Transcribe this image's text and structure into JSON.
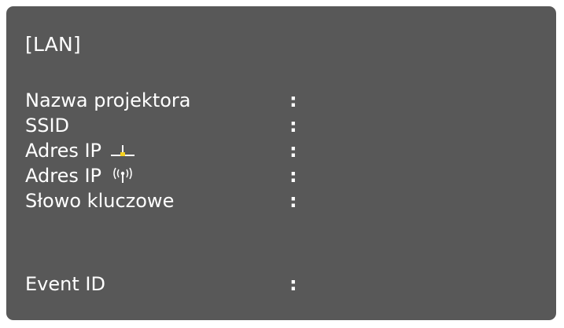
{
  "panel": {
    "title": "[LAN]"
  },
  "rows": [
    {
      "label": "Nazwa projektora",
      "separator": ":",
      "value": ""
    },
    {
      "label": "SSID",
      "separator": ":",
      "value": ""
    },
    {
      "label": "Adres IP",
      "icon": "wired-lan-icon",
      "separator": ":",
      "value": ""
    },
    {
      "label": "Adres IP",
      "icon": "wireless-lan-icon",
      "separator": ":",
      "value": ""
    },
    {
      "label": "Słowo kluczowe",
      "separator": ":",
      "value": ""
    },
    {
      "label": "Event ID",
      "separator": ":",
      "value": ""
    }
  ],
  "colors": {
    "panel_background": "#585858",
    "text": "#ffffff",
    "wired_icon_accent": "#f5d020"
  }
}
